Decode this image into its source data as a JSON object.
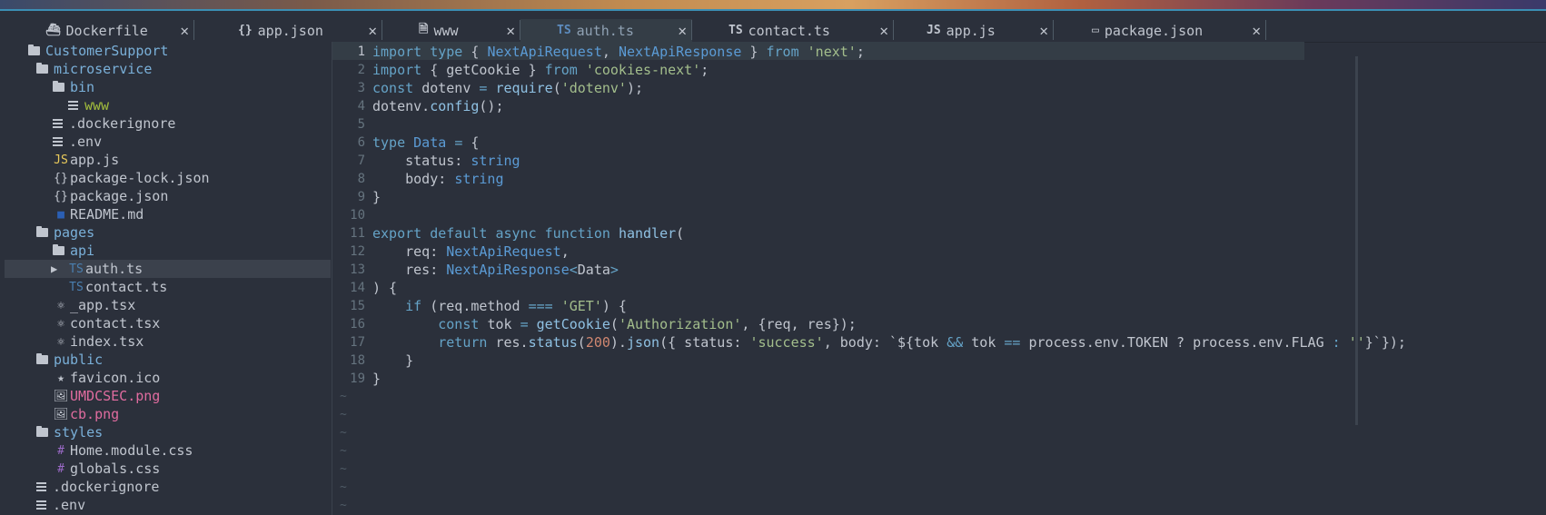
{
  "tabs": [
    {
      "icon": "whale-icon",
      "glyph": "⛴",
      "label": "Dockerfile",
      "active": false
    },
    {
      "icon": "json-icon",
      "glyph": "{}",
      "label": "app.json",
      "active": false
    },
    {
      "icon": "file-icon",
      "glyph": "🗎",
      "label": "www",
      "active": false
    },
    {
      "icon": "typescript-icon",
      "glyph": "TS",
      "label": "auth.ts",
      "active": true
    },
    {
      "icon": "typescript-icon",
      "glyph": "TS",
      "label": "contact.ts",
      "active": false
    },
    {
      "icon": "javascript-icon",
      "glyph": "JS",
      "label": "app.js",
      "active": false
    },
    {
      "icon": "npm-icon",
      "glyph": "▭",
      "label": "package.json",
      "active": false
    }
  ],
  "tab_close_glyph": "✕",
  "sidebar": {
    "items": [
      {
        "indent": 1,
        "kind": "folder",
        "label": "CustomerSupport",
        "color": "#7ab0d9"
      },
      {
        "indent": 2,
        "kind": "folder",
        "label": "microservice",
        "color": "#7ab0d9"
      },
      {
        "indent": 3,
        "kind": "folder",
        "label": "bin",
        "color": "#7ab0d9"
      },
      {
        "indent": 4,
        "kind": "file",
        "icon": "file-lines-icon",
        "label": "www",
        "color": "#a3be3c"
      },
      {
        "indent": 3,
        "kind": "file",
        "icon": "file-lines-icon",
        "label": ".dockerignore",
        "color": "#c0c5ce"
      },
      {
        "indent": 3,
        "kind": "file",
        "icon": "file-lines-icon",
        "label": ".env",
        "color": "#c0c5ce"
      },
      {
        "indent": 3,
        "kind": "file",
        "icon": "javascript-icon",
        "glyph": "JS",
        "glyph_color": "#ebcb5b",
        "label": "app.js",
        "color": "#c0c5ce"
      },
      {
        "indent": 3,
        "kind": "file",
        "icon": "json-icon",
        "glyph": "{}",
        "glyph_color": "#c0c5ce",
        "label": "package-lock.json",
        "color": "#c0c5ce"
      },
      {
        "indent": 3,
        "kind": "file",
        "icon": "json-icon",
        "glyph": "{}",
        "glyph_color": "#c0c5ce",
        "label": "package.json",
        "color": "#c0c5ce"
      },
      {
        "indent": 3,
        "kind": "file",
        "icon": "markdown-icon",
        "glyph": "■",
        "glyph_color": "#2b5fb4",
        "label": "README.md",
        "color": "#c0c5ce"
      },
      {
        "indent": 2,
        "kind": "folder",
        "label": "pages",
        "color": "#7ab0d9"
      },
      {
        "indent": 3,
        "kind": "folder",
        "label": "api",
        "color": "#7ab0d9"
      },
      {
        "indent": 3,
        "kind": "file",
        "icon": "typescript-icon",
        "glyph": "TS",
        "glyph_color": "#4a7fb0",
        "label": "auth.ts",
        "color": "#c0c5ce",
        "selected": true,
        "arrow": "▶"
      },
      {
        "indent": 4,
        "kind": "file",
        "icon": "typescript-icon",
        "glyph": "TS",
        "glyph_color": "#4a7fb0",
        "label": "contact.ts",
        "color": "#c0c5ce"
      },
      {
        "indent": 3,
        "kind": "file",
        "icon": "react-icon",
        "glyph": "⚛",
        "glyph_color": "#c0c5ce",
        "label": "_app.tsx",
        "color": "#c0c5ce"
      },
      {
        "indent": 3,
        "kind": "file",
        "icon": "react-icon",
        "glyph": "⚛",
        "glyph_color": "#c0c5ce",
        "label": "contact.tsx",
        "color": "#c0c5ce"
      },
      {
        "indent": 3,
        "kind": "file",
        "icon": "react-icon",
        "glyph": "⚛",
        "glyph_color": "#c0c5ce",
        "label": "index.tsx",
        "color": "#c0c5ce"
      },
      {
        "indent": 2,
        "kind": "folder",
        "label": "public",
        "color": "#7ab0d9"
      },
      {
        "indent": 3,
        "kind": "file",
        "icon": "star-icon",
        "glyph": "★",
        "glyph_color": "#c0c5ce",
        "label": "favicon.ico",
        "color": "#c0c5ce"
      },
      {
        "indent": 3,
        "kind": "file",
        "icon": "image-icon",
        "glyph": "🖼",
        "glyph_color": "#c0c5ce",
        "label": "UMDCSEC.png",
        "color": "#e06c9f"
      },
      {
        "indent": 3,
        "kind": "file",
        "icon": "image-icon",
        "glyph": "🖼",
        "glyph_color": "#c0c5ce",
        "label": "cb.png",
        "color": "#e06c9f"
      },
      {
        "indent": 2,
        "kind": "folder",
        "label": "styles",
        "color": "#7ab0d9"
      },
      {
        "indent": 3,
        "kind": "file",
        "icon": "css-icon",
        "glyph": "#",
        "glyph_color": "#9b6ac7",
        "label": "Home.module.css",
        "color": "#c0c5ce"
      },
      {
        "indent": 3,
        "kind": "file",
        "icon": "css-icon",
        "glyph": "#",
        "glyph_color": "#9b6ac7",
        "label": "globals.css",
        "color": "#c0c5ce"
      },
      {
        "indent": 2,
        "kind": "file",
        "icon": "file-lines-icon",
        "label": ".dockerignore",
        "color": "#c0c5ce"
      },
      {
        "indent": 2,
        "kind": "file",
        "icon": "file-lines-icon",
        "label": ".env",
        "color": "#c0c5ce"
      }
    ]
  },
  "editor": {
    "current_line": 1,
    "lines": [
      [
        [
          "kw",
          "import "
        ],
        [
          "kw",
          "type "
        ],
        [
          "pl",
          "{ "
        ],
        [
          "ty",
          "NextApiRequest"
        ],
        [
          "pl",
          ", "
        ],
        [
          "ty",
          "NextApiResponse"
        ],
        [
          "pl",
          " } "
        ],
        [
          "kw",
          "from "
        ],
        [
          "str",
          "'next'"
        ],
        [
          "pl",
          ";"
        ]
      ],
      [
        [
          "kw",
          "import "
        ],
        [
          "pl",
          "{ getCookie } "
        ],
        [
          "kw",
          "from "
        ],
        [
          "str",
          "'cookies-next'"
        ],
        [
          "pl",
          ";"
        ]
      ],
      [
        [
          "kw",
          "const "
        ],
        [
          "pl",
          "dotenv "
        ],
        [
          "op",
          "= "
        ],
        [
          "fn",
          "require"
        ],
        [
          "pl",
          "("
        ],
        [
          "str",
          "'dotenv'"
        ],
        [
          "pl",
          ");"
        ]
      ],
      [
        [
          "pl",
          "dotenv."
        ],
        [
          "fn",
          "config"
        ],
        [
          "pl",
          "();"
        ]
      ],
      [],
      [
        [
          "kw",
          "type "
        ],
        [
          "ty",
          "Data "
        ],
        [
          "op",
          "= "
        ],
        [
          "pl",
          "{"
        ]
      ],
      [
        [
          "pl",
          "    status: "
        ],
        [
          "ty",
          "string"
        ]
      ],
      [
        [
          "pl",
          "    body: "
        ],
        [
          "ty",
          "string"
        ]
      ],
      [
        [
          "pl",
          "}"
        ]
      ],
      [],
      [
        [
          "kw",
          "export "
        ],
        [
          "kw",
          "default "
        ],
        [
          "kw",
          "async "
        ],
        [
          "kw",
          "function "
        ],
        [
          "fn",
          "handler"
        ],
        [
          "pl",
          "("
        ]
      ],
      [
        [
          "pl",
          "    req: "
        ],
        [
          "ty",
          "NextApiRequest"
        ],
        [
          "pl",
          ","
        ]
      ],
      [
        [
          "pl",
          "    res: "
        ],
        [
          "ty",
          "NextApiResponse"
        ],
        [
          "op",
          "<"
        ],
        [
          "pl",
          "Data"
        ],
        [
          "op",
          ">"
        ]
      ],
      [
        [
          "pl",
          ") {"
        ]
      ],
      [
        [
          "pl",
          "    "
        ],
        [
          "kw",
          "if "
        ],
        [
          "pl",
          "(req.method "
        ],
        [
          "op",
          "=== "
        ],
        [
          "str",
          "'GET'"
        ],
        [
          "pl",
          ") {"
        ]
      ],
      [
        [
          "pl",
          "        "
        ],
        [
          "kw",
          "const "
        ],
        [
          "pl",
          "tok "
        ],
        [
          "op",
          "= "
        ],
        [
          "fn",
          "getCookie"
        ],
        [
          "pl",
          "("
        ],
        [
          "str",
          "'Authorization'"
        ],
        [
          "pl",
          ", {req, res});"
        ]
      ],
      [
        [
          "pl",
          "        "
        ],
        [
          "kw",
          "return "
        ],
        [
          "pl",
          "res."
        ],
        [
          "fn",
          "status"
        ],
        [
          "pl",
          "("
        ],
        [
          "num",
          "200"
        ],
        [
          "pl",
          ")."
        ],
        [
          "fn",
          "json"
        ],
        [
          "pl",
          "({ status: "
        ],
        [
          "str",
          "'success'"
        ],
        [
          "pl",
          ", body: `${tok "
        ],
        [
          "op",
          "&& "
        ],
        [
          "pl",
          "tok "
        ],
        [
          "op",
          "== "
        ],
        [
          "pl",
          "process.env.TOKEN ? process.env.FLAG "
        ],
        [
          "op",
          ": "
        ],
        [
          "str",
          "''"
        ],
        [
          "pl",
          "}`});"
        ]
      ],
      [
        [
          "pl",
          "    }"
        ]
      ],
      [
        [
          "pl",
          "}"
        ]
      ]
    ],
    "empty_marker": "~",
    "empty_marker_count": 7
  },
  "colors": {
    "kw": "#65a3c7",
    "ty": "#5b9bd5",
    "str": "#a3be8c",
    "fn": "#8fc1e3",
    "num": "#d08770",
    "op": "#65a3c7",
    "pl": "#c0c5ce"
  }
}
